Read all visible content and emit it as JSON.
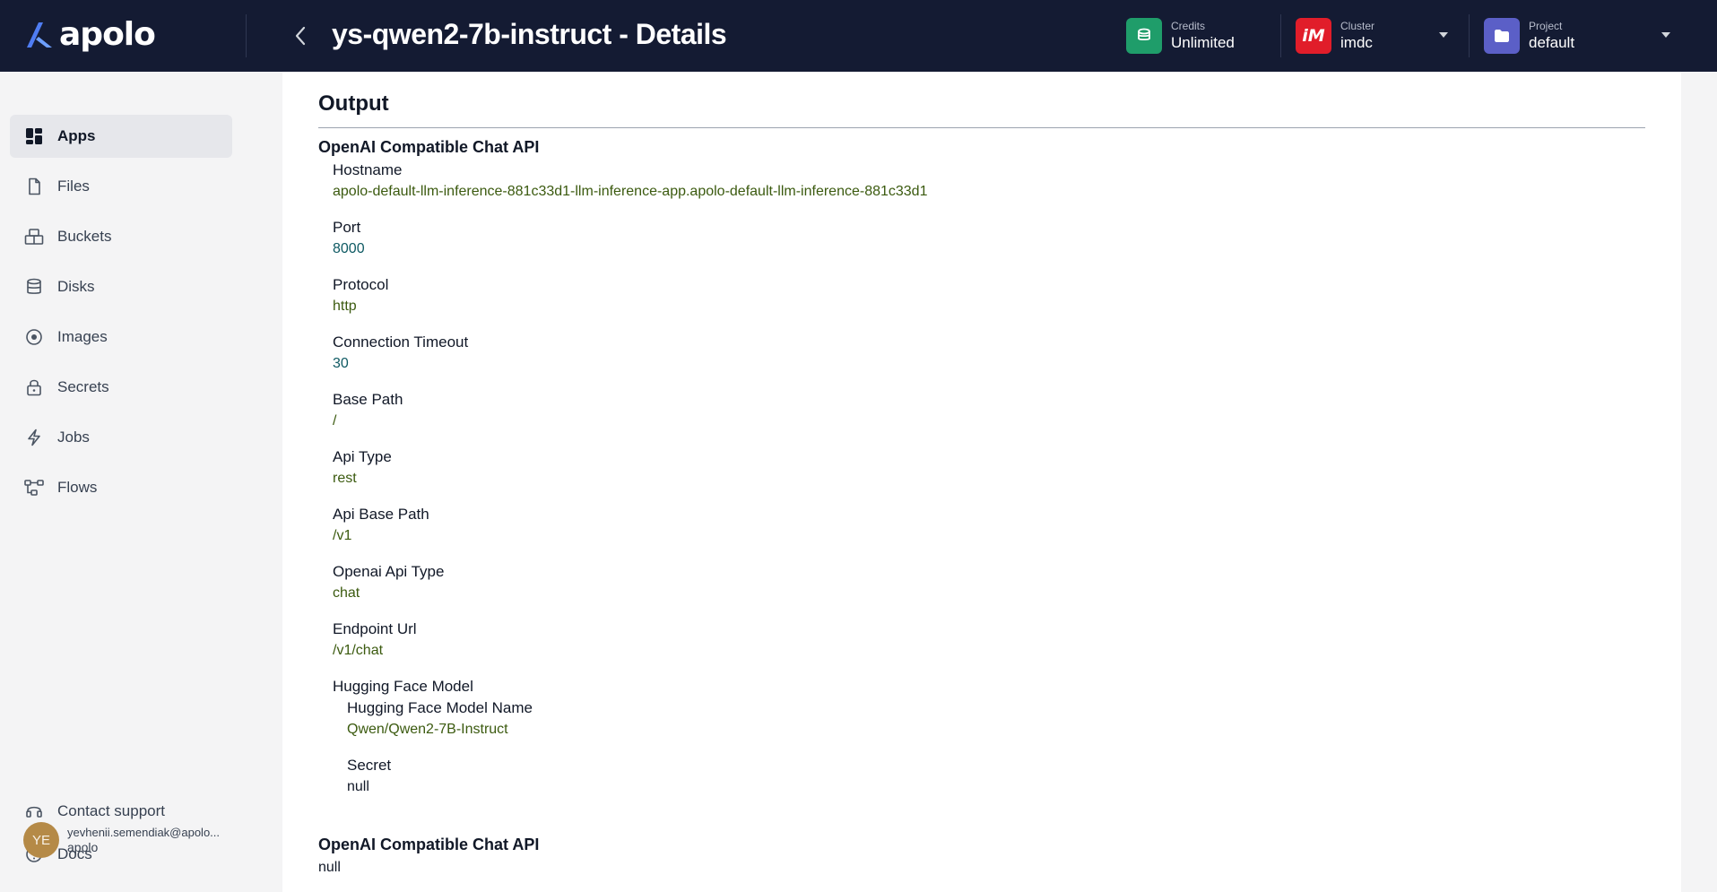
{
  "app": {
    "logo_text": "apolo",
    "page_title": "ys-qwen2-7b-instruct - Details"
  },
  "header": {
    "credits": {
      "label": "Credits",
      "value": "Unlimited",
      "color": "#1f9d6a"
    },
    "cluster": {
      "label": "Cluster",
      "value": "imdc",
      "icon_text": "iM",
      "color": "#e11d2a"
    },
    "project": {
      "label": "Project",
      "value": "default",
      "color": "#5b5fc7"
    }
  },
  "sidebar": {
    "items": [
      {
        "label": "Apps",
        "icon": "apps-grid-icon",
        "active": true
      },
      {
        "label": "Files",
        "icon": "file-icon"
      },
      {
        "label": "Buckets",
        "icon": "bucket-icon"
      },
      {
        "label": "Disks",
        "icon": "database-icon"
      },
      {
        "label": "Images",
        "icon": "image-disc-icon"
      },
      {
        "label": "Secrets",
        "icon": "lock-icon"
      },
      {
        "label": "Jobs",
        "icon": "lightning-icon"
      },
      {
        "label": "Flows",
        "icon": "flow-icon"
      }
    ],
    "footer": [
      {
        "label": "Contact support",
        "icon": "headset-icon"
      },
      {
        "label": "Docs",
        "icon": "help-circle-icon"
      }
    ],
    "user": {
      "initials": "YE",
      "email": "yevhenii.semendiak@apolo...",
      "org": "apolo"
    }
  },
  "output": {
    "title": "Output",
    "group_title": "OpenAI Compatible Chat API",
    "fields": [
      {
        "label": "Hostname",
        "value": "apolo-default-llm-inference-881c33d1-llm-inference-app.apolo-default-llm-inference-881c33d1"
      },
      {
        "label": "Port",
        "value": "8000"
      },
      {
        "label": "Protocol",
        "value": "http"
      },
      {
        "label": "Connection Timeout",
        "value": "30"
      },
      {
        "label": "Base Path",
        "value": "/"
      },
      {
        "label": "Api Type",
        "value": "rest"
      },
      {
        "label": "Api Base Path",
        "value": "/v1"
      },
      {
        "label": "Openai Api Type",
        "value": "chat"
      },
      {
        "label": "Endpoint Url",
        "value": "/v1/chat"
      }
    ],
    "hf_model": {
      "label": "Hugging Face Model",
      "name_label": "Hugging Face Model Name",
      "name_value": "Qwen/Qwen2-7B-Instruct",
      "secret_label": "Secret",
      "secret_value": "null"
    },
    "second_group": {
      "title": "OpenAI Compatible Chat API",
      "value": "null"
    }
  }
}
